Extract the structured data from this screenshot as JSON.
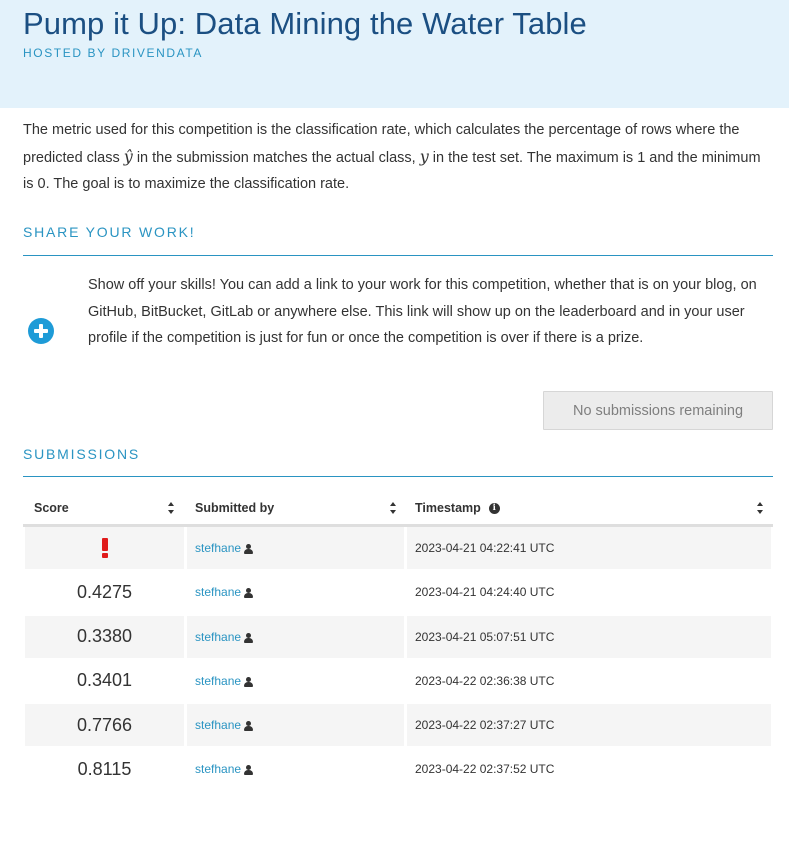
{
  "competition": {
    "title": "Pump it Up: Data Mining the Water Table",
    "hosted_by": "HOSTED BY DRIVENDATA"
  },
  "metric": {
    "part1": "The metric used for this competition is the classification rate, which calculates the percentage of rows where the predicted class ",
    "yhat": "ŷ",
    "part2": " in the submission matches the actual class, ",
    "y": "y",
    "part3": " in the test set. The maximum is 1 and the minimum is 0. The goal is to maximize the classification rate."
  },
  "share": {
    "heading": "SHARE YOUR WORK!",
    "description": "Show off your skills! You can add a link to your work for this competition, whether that is on your blog, on GitHub, BitBucket, GitLab or anywhere else. This link will show up on the leaderboard and in your user profile if the competition is just for fun or once the competition is over if there is a prize.",
    "icon": "plus-circle-icon",
    "button_label": "No submissions remaining"
  },
  "submissions": {
    "heading": "SUBMISSIONS",
    "columns": {
      "score": "Score",
      "submitted_by": "Submitted by",
      "timestamp": "Timestamp"
    },
    "rows": [
      {
        "score": "",
        "error": true,
        "user": "stefhane",
        "timestamp": "2023-04-21 04:22:41 UTC"
      },
      {
        "score": "0.4275",
        "error": false,
        "user": "stefhane",
        "timestamp": "2023-04-21 04:24:40 UTC"
      },
      {
        "score": "0.3380",
        "error": false,
        "user": "stefhane",
        "timestamp": "2023-04-21 05:07:51 UTC"
      },
      {
        "score": "0.3401",
        "error": false,
        "user": "stefhane",
        "timestamp": "2023-04-22 02:36:38 UTC"
      },
      {
        "score": "0.7766",
        "error": false,
        "user": "stefhane",
        "timestamp": "2023-04-22 02:37:27 UTC"
      },
      {
        "score": "0.8115",
        "error": false,
        "user": "stefhane",
        "timestamp": "2023-04-22 02:37:52 UTC"
      }
    ]
  },
  "colors": {
    "accent": "#2a94c2",
    "title": "#1b4f82",
    "header_background": "#e3f2fb",
    "error": "#e01b1b"
  }
}
